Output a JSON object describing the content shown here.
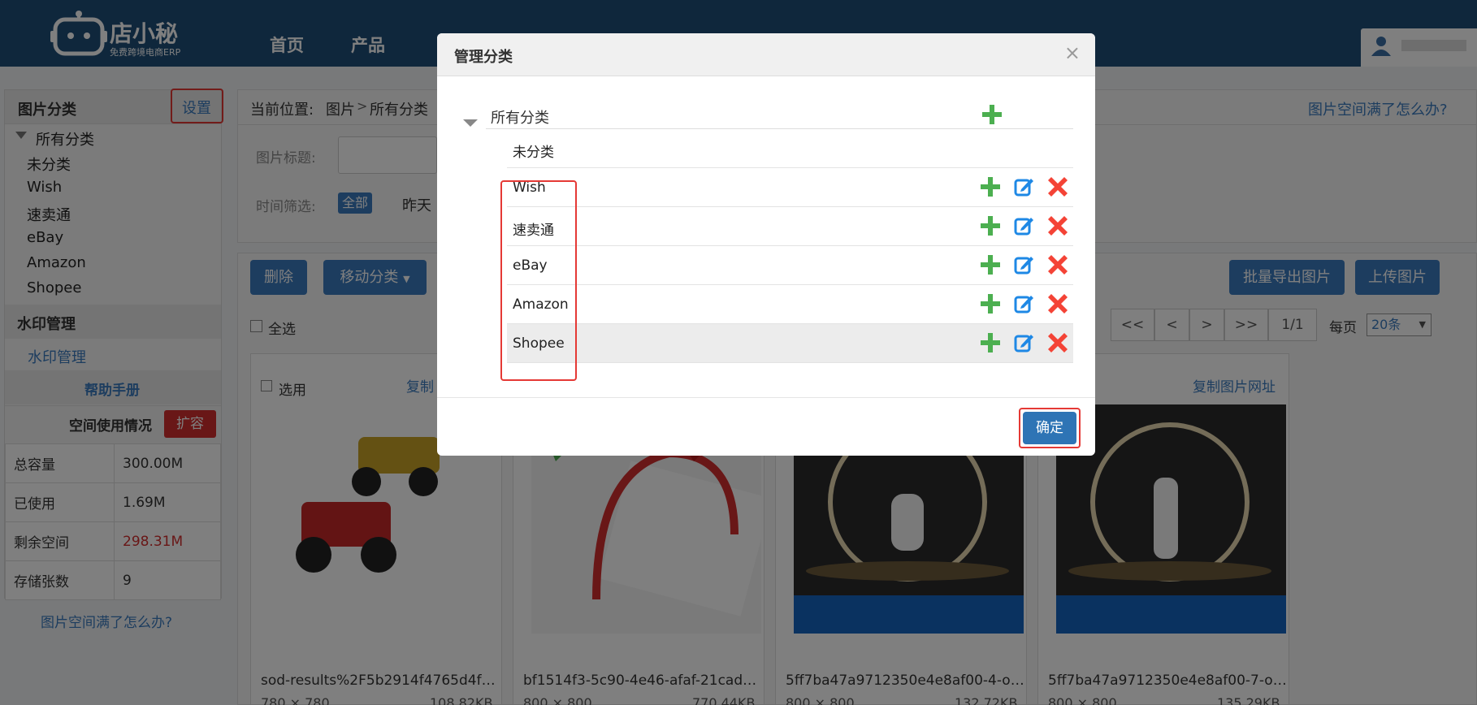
{
  "header": {
    "logo_text": "店小秘",
    "logo_sub": "免费跨境电商ERP",
    "nav": [
      "首页",
      "产品"
    ]
  },
  "sidebar": {
    "title": "图片分类",
    "settings": "设置",
    "tree_root": "所有分类",
    "categories": [
      "未分类",
      "Wish",
      "速卖通",
      "eBay",
      "Amazon",
      "Shopee"
    ],
    "watermark_head": "水印管理",
    "watermark_link": "水印管理",
    "help": "帮助手册",
    "space_title": "空间使用情况",
    "expand": "扩容",
    "stats": [
      {
        "label": "总容量",
        "value": "300.00M"
      },
      {
        "label": "已使用",
        "value": "1.69M"
      },
      {
        "label": "剩余空间",
        "value": "298.31M"
      },
      {
        "label": "存储张数",
        "value": "9"
      }
    ],
    "full_help": "图片空间满了怎么办?"
  },
  "main": {
    "location_label": "当前位置:",
    "crumb1": "图片",
    "crumb2": "所有分类",
    "full_help": "图片空间满了怎么办?",
    "title_label": "图片标题:",
    "time_label": "时间筛选:",
    "time_all": "全部",
    "time_yesterday": "昨天",
    "delete": "删除",
    "move": "移动分类",
    "export": "批量导出图片",
    "upload": "上传图片",
    "select_all": "全选",
    "pager": [
      "<<",
      "<",
      ">",
      ">>",
      "1/1"
    ],
    "per_page_label": "每页",
    "per_page_value": "20条",
    "select_label": "选用",
    "copy_url": "复制图片网址",
    "copy_short": "复制",
    "cards": [
      {
        "name": "sod-results%2F5b2914f4765d4f…",
        "dims": "780 × 780",
        "size": "108.82KB"
      },
      {
        "name": "bf1514f3-5c90-4e46-afaf-21cad…",
        "dims": "800 × 800",
        "size": "770.44KB"
      },
      {
        "name": "5ff7ba47a9712350e4e8af00-4-o…",
        "dims": "800 × 800",
        "size": "132.72KB"
      },
      {
        "name": "5ff7ba47a9712350e4e8af00-7-o…",
        "dims": "800 × 800",
        "size": "135.29KB"
      }
    ]
  },
  "modal": {
    "title": "管理分类",
    "close": "×",
    "root": "所有分类",
    "uncategorized": "未分类",
    "rows": [
      "Wish",
      "速卖通",
      "eBay",
      "Amazon",
      "Shopee"
    ],
    "confirm": "确定"
  },
  "colors": {
    "header": "#1f4e79",
    "primary": "#3a7bbf",
    "add": "#4caf50",
    "delete": "#f44336",
    "highlight": "#e53935"
  }
}
